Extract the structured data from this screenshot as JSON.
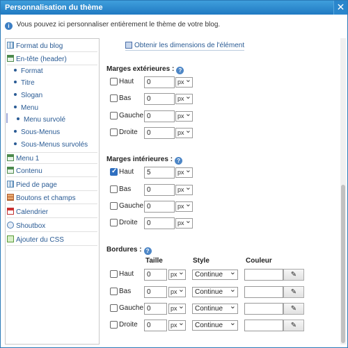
{
  "window": {
    "title": "Personnalisation du thème",
    "close_glyph": "✕"
  },
  "intro": {
    "text": "Vous pouvez ici personnaliser entièrement le thème de votre blog."
  },
  "sidebar": {
    "items": [
      {
        "label": "Format du blog",
        "icon": "layout-icon"
      },
      {
        "label": "En-tête (header)",
        "icon": "window-icon"
      },
      {
        "label": "Menu 1",
        "icon": "window-icon"
      },
      {
        "label": "Contenu",
        "icon": "window-icon"
      },
      {
        "label": "Pied de page",
        "icon": "layout-icon"
      },
      {
        "label": "Boutons et champs",
        "icon": "brick-icon"
      },
      {
        "label": "Calendrier",
        "icon": "calendar-icon"
      },
      {
        "label": "Shoutbox",
        "icon": "chat-icon"
      },
      {
        "label": "Ajouter du CSS",
        "icon": "css-icon"
      }
    ],
    "sub_items": [
      "Format",
      "Titre",
      "Slogan",
      "Menu",
      "Menu survolé",
      "Sous-Menus",
      "Sous-Menus survolés"
    ]
  },
  "content": {
    "dims_link": "Obtenir les dimensions de l'élément",
    "margin_outer": {
      "title": "Marges extérieures :",
      "rows": [
        {
          "label": "Haut",
          "value": "0",
          "unit": "px",
          "checked": false
        },
        {
          "label": "Bas",
          "value": "0",
          "unit": "px",
          "checked": false
        },
        {
          "label": "Gauche",
          "value": "0",
          "unit": "px",
          "checked": false
        },
        {
          "label": "Droite",
          "value": "0",
          "unit": "px",
          "checked": false
        }
      ]
    },
    "margin_inner": {
      "title": "Marges intérieures :",
      "rows": [
        {
          "label": "Haut",
          "value": "5",
          "unit": "px",
          "checked": true
        },
        {
          "label": "Bas",
          "value": "0",
          "unit": "px",
          "checked": false
        },
        {
          "label": "Gauche",
          "value": "0",
          "unit": "px",
          "checked": false
        },
        {
          "label": "Droite",
          "value": "0",
          "unit": "px",
          "checked": false
        }
      ]
    },
    "borders": {
      "title": "Bordures :",
      "col_size": "Taille",
      "col_style": "Style",
      "col_color": "Couleur",
      "rows": [
        {
          "label": "Haut",
          "value": "0",
          "unit": "px",
          "style": "Continue",
          "checked": false
        },
        {
          "label": "Bas",
          "value": "0",
          "unit": "px",
          "style": "Continue",
          "checked": false
        },
        {
          "label": "Gauche",
          "value": "0",
          "unit": "px",
          "style": "Continue",
          "checked": false
        },
        {
          "label": "Droite",
          "value": "0",
          "unit": "px",
          "style": "Continue",
          "checked": false
        }
      ]
    },
    "help_glyph": "?",
    "info_glyph": "i",
    "picker_glyph": "✎"
  },
  "colors": {
    "titlebar": "#2079c2",
    "link": "#2a5b94",
    "checkbox_checked": "#2f6fc0"
  }
}
